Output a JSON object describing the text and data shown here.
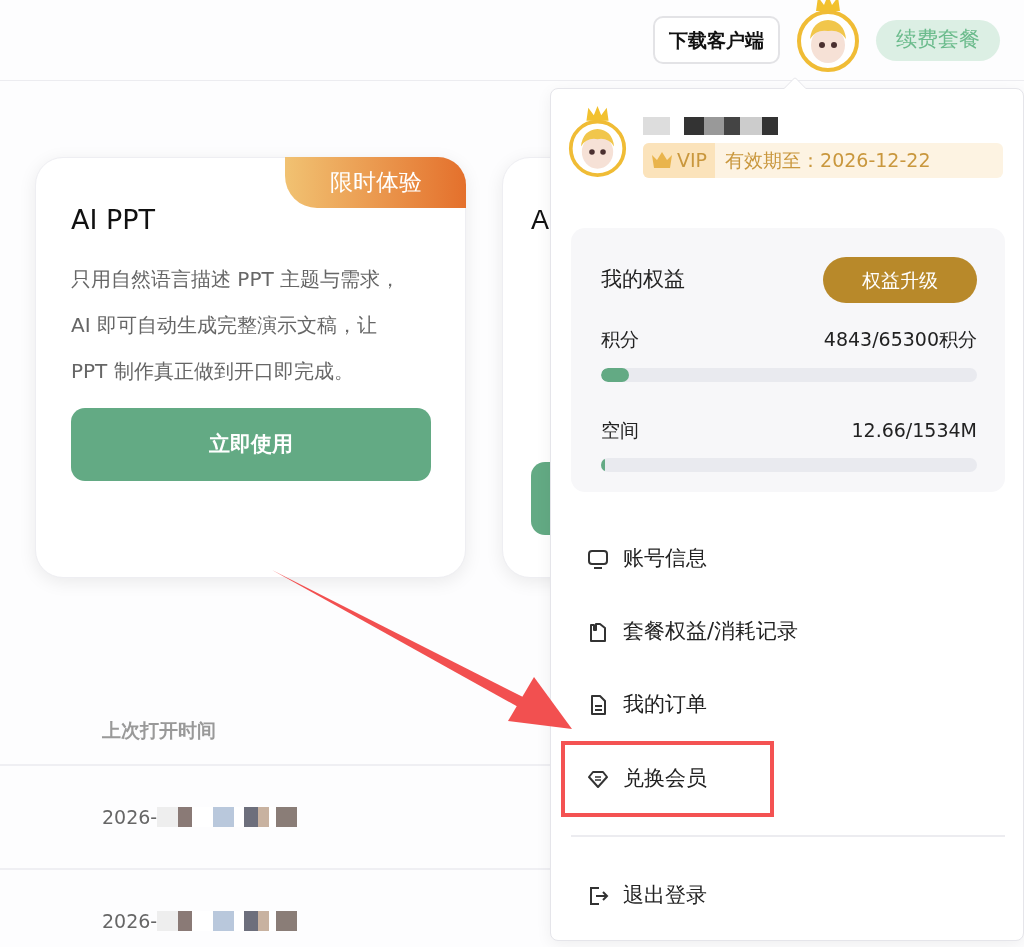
{
  "header": {
    "download_button": "下载客户端",
    "renew_button": "续费套餐"
  },
  "cards": [
    {
      "kind": "full",
      "title": "AI PPT",
      "tag": "限时体验",
      "description": "只用自然语言描述 PPT 主题与需求，AI 即可自动生成完整演示文稿，让 PPT 制作真正做到开口即完成。",
      "button": "立即使用"
    },
    {
      "kind": "covered",
      "title": "A"
    }
  ],
  "table": {
    "columns": [
      "上次打开时间"
    ],
    "rows": [
      {
        "cells": [
          "2026-"
        ]
      },
      {
        "cells": [
          "2026-"
        ]
      }
    ]
  },
  "account_menu": {
    "user": {
      "vip_label": "VIP",
      "expiry": "有效期至：2026-12-22"
    },
    "benefits": {
      "title": "我的权益",
      "upgrade_button": "权益升级",
      "meters": [
        {
          "label": "积分",
          "reading": "4843/65300积分",
          "level": 0.074
        },
        {
          "label": "空间",
          "reading": "12.66/1534M",
          "level": 0.008
        }
      ]
    },
    "items": [
      {
        "label": "账号信息",
        "highlighted": false
      },
      {
        "label": "套餐权益/消耗记录",
        "highlighted": false
      },
      {
        "label": "我的订单",
        "highlighted": false
      },
      {
        "label": "兑换会员",
        "highlighted": true
      },
      {
        "label": "退出登录",
        "highlighted": false
      }
    ]
  },
  "annotation": {
    "arrow": true
  }
}
